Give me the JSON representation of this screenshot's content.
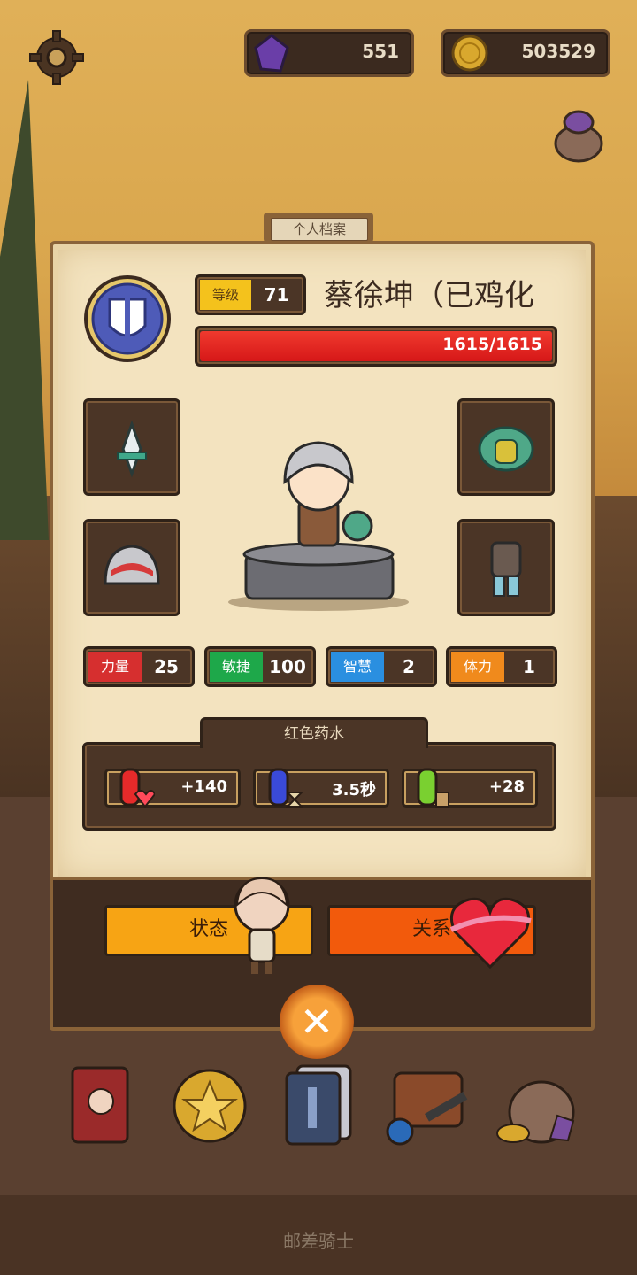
{
  "topbar": {
    "gems": "551",
    "coins": "503529"
  },
  "profile": {
    "tab_label": "个人档案",
    "level_label": "等级",
    "level_value": "71",
    "character_name": "蔡徐坤（已鸡化",
    "hp_text": "1615/1615",
    "hp_fraction": 1.0
  },
  "equipment": [
    {
      "slot": "weapon",
      "icon": "sword-icon"
    },
    {
      "slot": "armor",
      "icon": "armor-icon"
    },
    {
      "slot": "helmet",
      "icon": "helmet-icon"
    },
    {
      "slot": "body",
      "icon": "body-armor-icon"
    }
  ],
  "stats": [
    {
      "label": "力量",
      "value": "25",
      "color": "#d62f2f"
    },
    {
      "label": "敏捷",
      "value": "100",
      "color": "#1ea84a"
    },
    {
      "label": "智慧",
      "value": "2",
      "color": "#2a8fe0"
    },
    {
      "label": "体力",
      "value": "1",
      "color": "#f08a1c"
    }
  ],
  "potions": {
    "title": "红色药水",
    "items": [
      {
        "value": "+140",
        "icon": "red-potion-icon"
      },
      {
        "value": "3.5秒",
        "icon": "blue-potion-icon"
      },
      {
        "value": "+28",
        "icon": "green-potion-icon"
      }
    ]
  },
  "actions": {
    "status_label": "状态",
    "relation_label": "关系"
  },
  "footer": {
    "title": "邮差骑士"
  },
  "colors": {
    "status_button": "#f7a414",
    "relation_button": "#f25a0c",
    "hp_bar": "#e02020",
    "level_badge": "#f4c21c"
  }
}
